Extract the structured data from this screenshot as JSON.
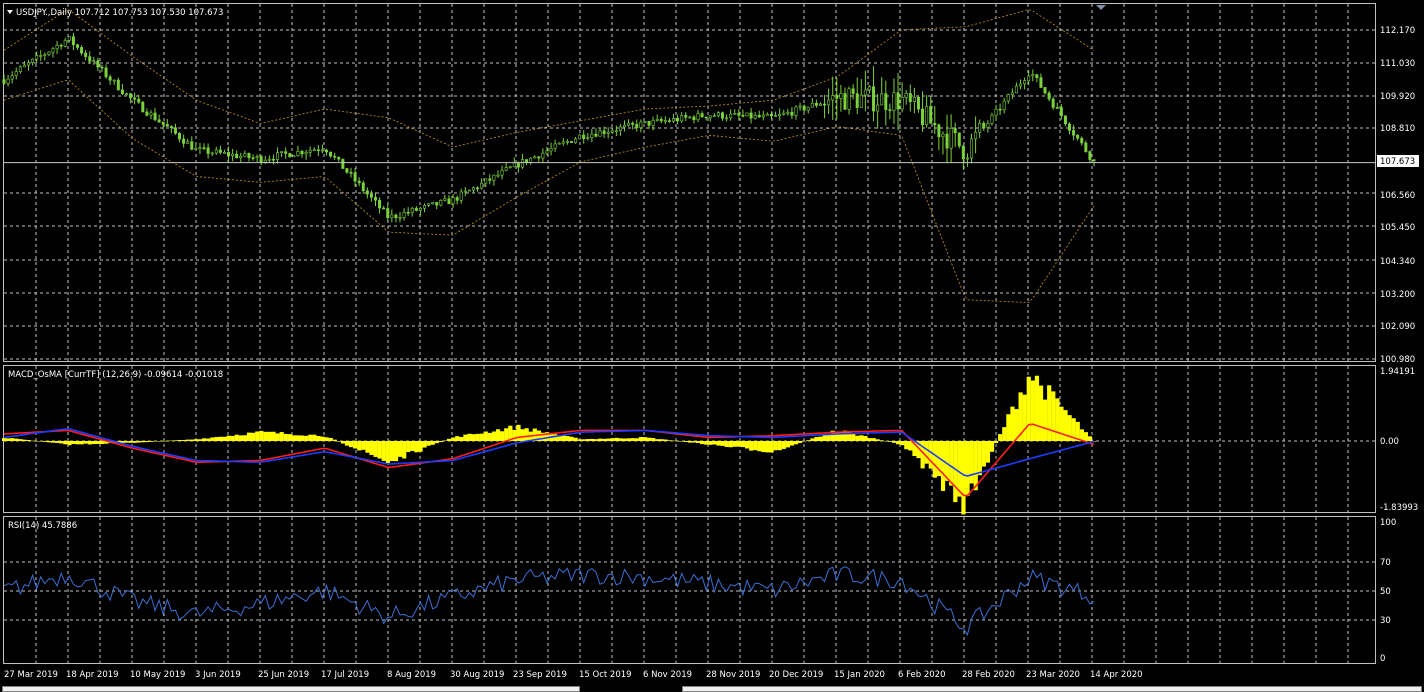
{
  "window": {
    "symbol_header": "USDJPY.,Daily  107.712 107.753 107.530 107.673",
    "dropdown_icon": "triangle-down-icon",
    "scroll_marker_icon": "triangle-down-icon"
  },
  "colors": {
    "background": "#000000",
    "grid": "#c0c0c0",
    "candle": "#7bd23c",
    "bollinger": "#c8941e",
    "osma_histogram": "#ffff00",
    "macd_main": "#ff1e1e",
    "macd_signal": "#1e3cff",
    "rsi": "#3c6ed2"
  },
  "price_axis": {
    "labels": [
      "112.170",
      "111.030",
      "109.920",
      "108.810",
      "107.673",
      "106.560",
      "105.450",
      "104.340",
      "103.200",
      "102.090",
      "100.980"
    ],
    "current_price": "107.673"
  },
  "time_axis": {
    "labels": [
      "27 Mar 2019",
      "18 Apr 2019",
      "10 May 2019",
      "3 Jun 2019",
      "25 Jun 2019",
      "17 Jul 2019",
      "8 Aug 2019",
      "30 Aug 2019",
      "23 Sep 2019",
      "15 Oct 2019",
      "6 Nov 2019",
      "28 Nov 2019",
      "20 Dec 2019",
      "15 Jan 2020",
      "6 Feb 2020",
      "28 Feb 2020",
      "23 Mar 2020",
      "14 Apr 2020"
    ]
  },
  "macd_panel": {
    "title": "MACD_OsMA [CurrTF] (12,26,9) -0.09614 -0.01018",
    "axis_labels": [
      "1.94191",
      "0.00",
      "-1.83993"
    ]
  },
  "rsi_panel": {
    "title": "RSI(14) 45.7886",
    "axis_labels": [
      "100",
      "70",
      "50",
      "30",
      "0"
    ]
  },
  "chart_data": [
    {
      "type": "candlestick",
      "title": "USDJPY.,Daily",
      "last_bar": {
        "open": 107.712,
        "high": 107.753,
        "low": 107.53,
        "close": 107.673
      },
      "ylim": [
        100.98,
        112.6
      ],
      "x": [
        "27 Mar 2019",
        "18 Apr 2019",
        "10 May 2019",
        "3 Jun 2019",
        "25 Jun 2019",
        "17 Jul 2019",
        "8 Aug 2019",
        "30 Aug 2019",
        "23 Sep 2019",
        "15 Oct 2019",
        "6 Nov 2019",
        "28 Nov 2019",
        "20 Dec 2019",
        "15 Jan 2020",
        "6 Feb 2020",
        "28 Feb 2020",
        "23 Mar 2020",
        "14 Apr 2020"
      ],
      "close": [
        110.5,
        111.9,
        109.8,
        108.1,
        107.8,
        108.2,
        105.8,
        106.4,
        107.6,
        108.6,
        109.0,
        109.3,
        109.2,
        109.9,
        109.8,
        108.1,
        110.8,
        107.7
      ],
      "upper_band": [
        111.5,
        112.9,
        111.3,
        109.8,
        109.0,
        109.5,
        109.2,
        108.2,
        108.7,
        109.1,
        109.5,
        109.6,
        109.8,
        110.6,
        112.2,
        112.3,
        112.9,
        111.5
      ],
      "lower_band": [
        109.8,
        110.5,
        108.5,
        107.2,
        107.0,
        107.2,
        105.3,
        105.2,
        106.5,
        107.7,
        108.2,
        108.6,
        108.4,
        108.9,
        108.6,
        103.0,
        102.9,
        106.2
      ]
    },
    {
      "type": "bar",
      "title": "MACD_OsMA [CurrTF] (12,26,9)",
      "ylim": [
        -1.83993,
        1.94191
      ],
      "x": [
        "27 Mar 2019",
        "18 Apr 2019",
        "10 May 2019",
        "3 Jun 2019",
        "25 Jun 2019",
        "17 Jul 2019",
        "8 Aug 2019",
        "30 Aug 2019",
        "23 Sep 2019",
        "15 Oct 2019",
        "6 Nov 2019",
        "28 Nov 2019",
        "20 Dec 2019",
        "15 Jan 2020",
        "6 Feb 2020",
        "28 Feb 2020",
        "23 Mar 2020",
        "14 Apr 2020"
      ],
      "osma": [
        0.1,
        -0.1,
        -0.05,
        0.05,
        0.25,
        0.15,
        -0.6,
        0.1,
        0.4,
        0.05,
        0.1,
        -0.1,
        -0.3,
        0.3,
        -0.1,
        -1.8,
        1.9,
        -0.01018
      ],
      "series": [
        {
          "name": "main",
          "values": [
            0.2,
            0.3,
            -0.2,
            -0.6,
            -0.55,
            -0.2,
            -0.75,
            -0.5,
            0.1,
            0.3,
            0.3,
            0.1,
            0.15,
            0.25,
            0.3,
            -1.6,
            0.5,
            -0.09614
          ]
        },
        {
          "name": "signal",
          "values": [
            0.1,
            0.35,
            -0.15,
            -0.55,
            -0.6,
            -0.3,
            -0.65,
            -0.55,
            -0.05,
            0.25,
            0.3,
            0.15,
            0.1,
            0.2,
            0.25,
            -1.0,
            -0.5,
            -0.01018
          ]
        }
      ]
    },
    {
      "type": "line",
      "title": "RSI(14)",
      "ylim": [
        0,
        100
      ],
      "levels": [
        70,
        50,
        30
      ],
      "x": [
        "27 Mar 2019",
        "18 Apr 2019",
        "10 May 2019",
        "3 Jun 2019",
        "25 Jun 2019",
        "17 Jul 2019",
        "8 Aug 2019",
        "30 Aug 2019",
        "23 Sep 2019",
        "15 Oct 2019",
        "6 Nov 2019",
        "28 Nov 2019",
        "20 Dec 2019",
        "15 Jan 2020",
        "6 Feb 2020",
        "28 Feb 2020",
        "23 Mar 2020",
        "14 Apr 2020"
      ],
      "values": [
        50,
        62,
        42,
        32,
        40,
        50,
        30,
        45,
        58,
        62,
        60,
        55,
        50,
        62,
        58,
        22,
        60,
        45.7886
      ]
    }
  ]
}
